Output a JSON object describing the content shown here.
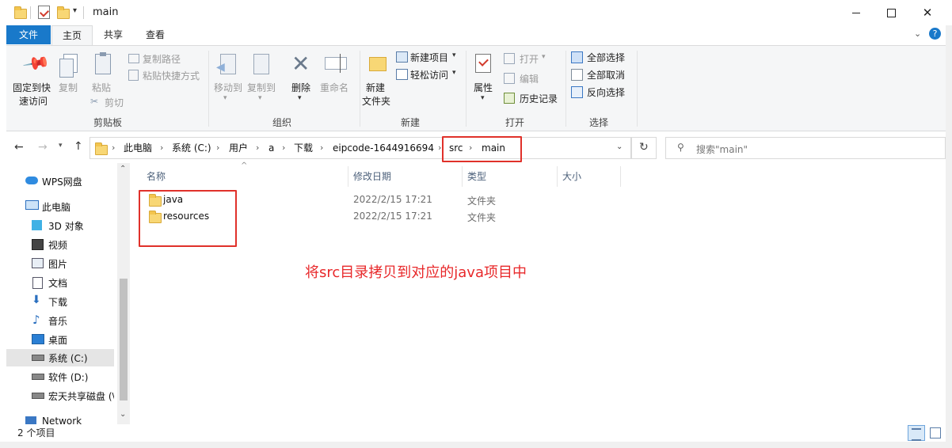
{
  "window": {
    "title": "main",
    "minimize": "—",
    "maximize": "☐",
    "close": "✕"
  },
  "tabs": [
    {
      "label": "文件"
    },
    {
      "label": "主页"
    },
    {
      "label": "共享"
    },
    {
      "label": "查看"
    }
  ],
  "ribbon": {
    "clipboard": {
      "pin_label_1": "固定到快",
      "pin_label_2": "速访问",
      "copy": "复制",
      "paste": "粘贴",
      "copy_path": "复制路径",
      "paste_shortcut": "粘贴快捷方式",
      "cut": "剪切",
      "group": "剪贴板"
    },
    "organize": {
      "move_to": "移动到",
      "copy_to": "复制到",
      "delete": "删除",
      "rename": "重命名",
      "group": "组织"
    },
    "new": {
      "new_folder_1": "新建",
      "new_folder_2": "文件夹",
      "new_item": "新建项目",
      "easy_access": "轻松访问",
      "group": "新建"
    },
    "open": {
      "properties": "属性",
      "open": "打开",
      "edit": "编辑",
      "history": "历史记录",
      "group": "打开"
    },
    "select": {
      "select_all": "全部选择",
      "select_none": "全部取消",
      "invert": "反向选择",
      "group": "选择"
    }
  },
  "address": {
    "crumbs": [
      "此电脑",
      "系统 (C:)",
      "用户",
      "a",
      "下载",
      "eipcode-1644916694",
      "src",
      "main"
    ]
  },
  "search": {
    "placeholder": "搜索\"main\""
  },
  "nav": [
    {
      "label": "WPS网盘"
    },
    {
      "label": "此电脑"
    },
    {
      "label": "3D 对象"
    },
    {
      "label": "视频"
    },
    {
      "label": "图片"
    },
    {
      "label": "文档"
    },
    {
      "label": "下载"
    },
    {
      "label": "音乐"
    },
    {
      "label": "桌面"
    },
    {
      "label": "系统 (C:)"
    },
    {
      "label": "软件 (D:)"
    },
    {
      "label": "宏天共享磁盘 (\\"
    },
    {
      "label": "Network"
    }
  ],
  "columns": {
    "name": "名称",
    "modified": "修改日期",
    "type": "类型",
    "size": "大小"
  },
  "files": [
    {
      "name": "java",
      "modified": "2022/2/15 17:21",
      "type": "文件夹"
    },
    {
      "name": "resources",
      "modified": "2022/2/15 17:21",
      "type": "文件夹"
    }
  ],
  "status": {
    "count": "2 个项目"
  },
  "annotation": "将src目录拷贝到对应的java项目中",
  "colors": {
    "accent": "#1979ca",
    "annotation_red": "#e0312a",
    "selected_nav": "#e5f3ff"
  }
}
